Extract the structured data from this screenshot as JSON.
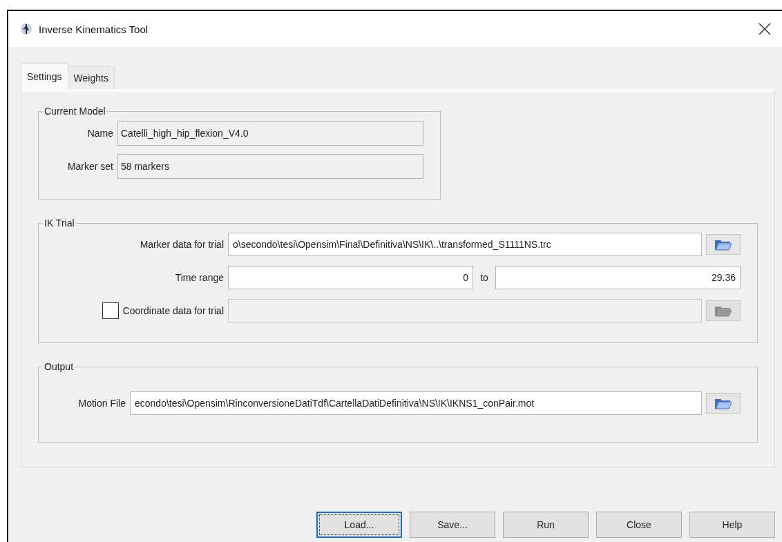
{
  "window": {
    "title": "Inverse Kinematics Tool"
  },
  "tabs": [
    {
      "label": "Settings",
      "selected": true
    },
    {
      "label": "Weights",
      "selected": false
    }
  ],
  "current_model": {
    "title": "Current Model",
    "fields": [
      {
        "label": "Name",
        "value": "Catelli_high_hip_flexion_V4.0"
      },
      {
        "label": "Marker set",
        "value": "58 markers"
      }
    ]
  },
  "ik_trial": {
    "title": "IK Trial",
    "marker_data": {
      "label": "Marker data for trial",
      "value": "o\\secondo\\tesi\\Opensim\\Final\\Definitiva\\NS\\IK\\..\\transformed_S1111NS.trc"
    },
    "time_range": {
      "label": "Time range",
      "from": "0",
      "separator": "to",
      "to": "29.36"
    },
    "coordinate_data": {
      "label": "Coordinate data for trial",
      "checked": false,
      "disabled": true
    }
  },
  "output": {
    "title": "Output",
    "motion_file": {
      "label": "Motion File",
      "value": "econdo\\tesi\\Opensim\\RinconversioneDatiTdf\\CartellaDatiDefinitiva\\NS\\IK\\IKNS1_conPair.mot"
    }
  },
  "buttons": [
    {
      "label": "Load...",
      "focused": true
    },
    {
      "label": "Save...",
      "focused": false
    },
    {
      "label": "Run",
      "focused": false
    },
    {
      "label": "Close",
      "focused": false
    },
    {
      "label": "Help",
      "focused": false
    }
  ]
}
